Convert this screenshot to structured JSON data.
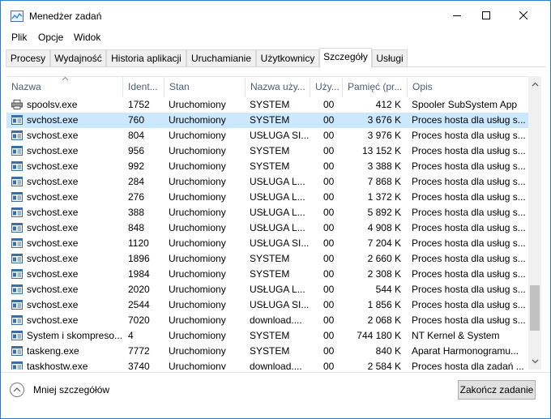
{
  "window": {
    "title": "Menedżer zadań"
  },
  "menu": {
    "items": [
      "Plik",
      "Opcje",
      "Widok"
    ]
  },
  "tabs": [
    {
      "label": "Procesy",
      "active": false
    },
    {
      "label": "Wydajność",
      "active": false
    },
    {
      "label": "Historia aplikacji",
      "active": false
    },
    {
      "label": "Uruchamianie",
      "active": false
    },
    {
      "label": "Użytkownicy",
      "active": false
    },
    {
      "label": "Szczegóły",
      "active": true
    },
    {
      "label": "Usługi",
      "active": false
    }
  ],
  "table": {
    "columns": [
      "Nazwa",
      "Ident...",
      "Stan",
      "Nazwa uży...",
      "Uży...",
      "Pamięć (pr...",
      "Opis"
    ],
    "sorted_column": "Nazwa",
    "selected_row": 1,
    "rows": [
      {
        "icon": "printer-icon",
        "name": "spoolsv.exe",
        "pid": "1752",
        "status": "Uruchomiony",
        "user": "SYSTEM",
        "session": "00",
        "memory": "412 K",
        "desc": "Spooler SubSystem App"
      },
      {
        "icon": "service-host-icon",
        "name": "svchost.exe",
        "pid": "760",
        "status": "Uruchomiony",
        "user": "SYSTEM",
        "session": "00",
        "memory": "3 676 K",
        "desc": "Proces hosta dla usług s..."
      },
      {
        "icon": "service-host-icon",
        "name": "svchost.exe",
        "pid": "804",
        "status": "Uruchomiony",
        "user": "USŁUGA SI...",
        "session": "00",
        "memory": "3 976 K",
        "desc": "Proces hosta dla usług s..."
      },
      {
        "icon": "service-host-icon",
        "name": "svchost.exe",
        "pid": "956",
        "status": "Uruchomiony",
        "user": "SYSTEM",
        "session": "00",
        "memory": "13 152 K",
        "desc": "Proces hosta dla usług s..."
      },
      {
        "icon": "service-host-icon",
        "name": "svchost.exe",
        "pid": "992",
        "status": "Uruchomiony",
        "user": "SYSTEM",
        "session": "00",
        "memory": "3 388 K",
        "desc": "Proces hosta dla usług s..."
      },
      {
        "icon": "service-host-icon",
        "name": "svchost.exe",
        "pid": "284",
        "status": "Uruchomiony",
        "user": "USŁUGA L...",
        "session": "00",
        "memory": "7 868 K",
        "desc": "Proces hosta dla usług s..."
      },
      {
        "icon": "service-host-icon",
        "name": "svchost.exe",
        "pid": "276",
        "status": "Uruchomiony",
        "user": "USŁUGA L...",
        "session": "00",
        "memory": "1 372 K",
        "desc": "Proces hosta dla usług s..."
      },
      {
        "icon": "service-host-icon",
        "name": "svchost.exe",
        "pid": "388",
        "status": "Uruchomiony",
        "user": "USŁUGA L...",
        "session": "00",
        "memory": "5 892 K",
        "desc": "Proces hosta dla usług s..."
      },
      {
        "icon": "service-host-icon",
        "name": "svchost.exe",
        "pid": "848",
        "status": "Uruchomiony",
        "user": "USŁUGA L...",
        "session": "00",
        "memory": "4 908 K",
        "desc": "Proces hosta dla usług s..."
      },
      {
        "icon": "service-host-icon",
        "name": "svchost.exe",
        "pid": "1120",
        "status": "Uruchomiony",
        "user": "USŁUGA SI...",
        "session": "00",
        "memory": "7 204 K",
        "desc": "Proces hosta dla usług s..."
      },
      {
        "icon": "service-host-icon",
        "name": "svchost.exe",
        "pid": "1896",
        "status": "Uruchomiony",
        "user": "SYSTEM",
        "session": "00",
        "memory": "2 660 K",
        "desc": "Proces hosta dla usług s..."
      },
      {
        "icon": "service-host-icon",
        "name": "svchost.exe",
        "pid": "1984",
        "status": "Uruchomiony",
        "user": "SYSTEM",
        "session": "00",
        "memory": "2 308 K",
        "desc": "Proces hosta dla usług s..."
      },
      {
        "icon": "service-host-icon",
        "name": "svchost.exe",
        "pid": "2020",
        "status": "Uruchomiony",
        "user": "USŁUGA L...",
        "session": "00",
        "memory": "544 K",
        "desc": "Proces hosta dla usług s..."
      },
      {
        "icon": "service-host-icon",
        "name": "svchost.exe",
        "pid": "2544",
        "status": "Uruchomiony",
        "user": "USŁUGA SI...",
        "session": "00",
        "memory": "1 856 K",
        "desc": "Proces hosta dla usług s..."
      },
      {
        "icon": "service-host-icon",
        "name": "svchost.exe",
        "pid": "7020",
        "status": "Uruchomiony",
        "user": "download....",
        "session": "00",
        "memory": "2 068 K",
        "desc": "Proces hosta dla usług s..."
      },
      {
        "icon": "service-host-icon",
        "name": "System i skompreso...",
        "pid": "4",
        "status": "Uruchomiony",
        "user": "SYSTEM",
        "session": "00",
        "memory": "744 180 K",
        "desc": "NT Kernel & System"
      },
      {
        "icon": "service-host-icon",
        "name": "taskeng.exe",
        "pid": "7772",
        "status": "Uruchomiony",
        "user": "SYSTEM",
        "session": "00",
        "memory": "840 K",
        "desc": "Aparat Harmonogramu..."
      },
      {
        "icon": "service-host-icon",
        "name": "taskhostw.exe",
        "pid": "3740",
        "status": "Uruchomiony",
        "user": "download....",
        "session": "00",
        "memory": "2 584 K",
        "desc": "Proces hosta dla zadań ..."
      }
    ]
  },
  "footer": {
    "less_details_label": "Mniej szczegółów",
    "end_task_label": "Zakończ zadanie"
  },
  "colors": {
    "selected_row": "#cce8ff",
    "header_text": "#4c607a",
    "window_border": "#2b7bd0"
  }
}
